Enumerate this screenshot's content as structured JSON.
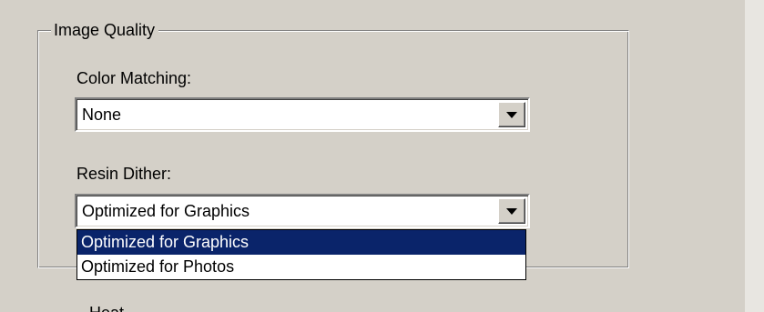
{
  "group": {
    "title": "Image Quality",
    "color_matching": {
      "label": "Color Matching:",
      "value": "None"
    },
    "resin_dither": {
      "label": "Resin Dither:",
      "value": "Optimized for Graphics",
      "options": [
        {
          "label": "Optimized for Graphics",
          "selected": true
        },
        {
          "label": "Optimized for Photos",
          "selected": false
        }
      ]
    }
  },
  "next_section": {
    "label_partial": "Heat"
  },
  "colors": {
    "dialog_background": "#d4d0c8",
    "selection_background": "#0a246a",
    "selection_text": "#ffffff"
  },
  "icons": {
    "combo_arrow": "chevron-down-icon"
  }
}
